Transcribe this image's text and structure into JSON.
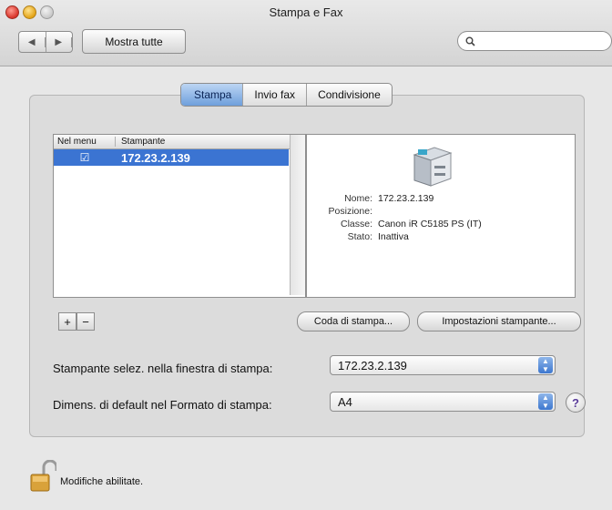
{
  "window": {
    "title": "Stampa e Fax",
    "traffic_lights": [
      "close",
      "minimize",
      "zoom"
    ]
  },
  "toolbar": {
    "back_glyph": "◀",
    "forward_glyph": "▶",
    "show_all_label": "Mostra tutte",
    "search": {
      "value": "",
      "placeholder": ""
    }
  },
  "tabs": [
    {
      "label": "Stampa",
      "selected": true
    },
    {
      "label": "Invio fax",
      "selected": false
    },
    {
      "label": "Condivisione",
      "selected": false
    }
  ],
  "printer_list": {
    "columns": [
      "Nel menu",
      "Stampante"
    ],
    "rows": [
      {
        "in_menu": true,
        "check_glyph": "☑",
        "name": "172.23.2.139",
        "selected": true
      }
    ]
  },
  "printer_details": {
    "rows": [
      {
        "label": "Nome:",
        "value": "172.23.2.139"
      },
      {
        "label": "Posizione:",
        "value": ""
      },
      {
        "label": "Classe:",
        "value": "Canon iR C5185 PS (IT)"
      },
      {
        "label": "Stato:",
        "value": "Inattiva"
      }
    ]
  },
  "list_buttons": {
    "add": "+",
    "remove": "−"
  },
  "actions": {
    "queue_label": "Coda di stampa...",
    "settings_label": "Impostazioni stampante..."
  },
  "settings": {
    "default_printer_label": "Stampante selez. nella finestra di stampa:",
    "default_printer_value": "172.23.2.139",
    "paper_size_label": "Dimens. di default nel Formato di stampa:",
    "paper_size_value": "A4"
  },
  "help_glyph": "?",
  "footer": {
    "lock_text": "Modifiche abilitate."
  },
  "colors": {
    "selection": "#3b74d2",
    "tab_active": "#6e9fdc"
  }
}
